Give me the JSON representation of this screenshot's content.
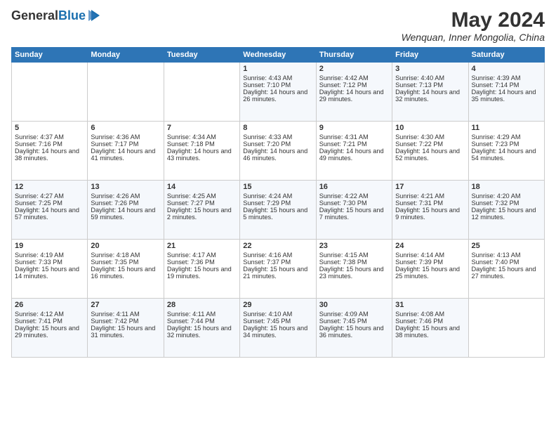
{
  "header": {
    "logo_line1": "General",
    "logo_line2": "Blue",
    "month_year": "May 2024",
    "location": "Wenquan, Inner Mongolia, China"
  },
  "days_of_week": [
    "Sunday",
    "Monday",
    "Tuesday",
    "Wednesday",
    "Thursday",
    "Friday",
    "Saturday"
  ],
  "weeks": [
    [
      {
        "day": "",
        "info": ""
      },
      {
        "day": "",
        "info": ""
      },
      {
        "day": "",
        "info": ""
      },
      {
        "day": "1",
        "info": "Sunrise: 4:43 AM\nSunset: 7:10 PM\nDaylight: 14 hours and 26 minutes."
      },
      {
        "day": "2",
        "info": "Sunrise: 4:42 AM\nSunset: 7:12 PM\nDaylight: 14 hours and 29 minutes."
      },
      {
        "day": "3",
        "info": "Sunrise: 4:40 AM\nSunset: 7:13 PM\nDaylight: 14 hours and 32 minutes."
      },
      {
        "day": "4",
        "info": "Sunrise: 4:39 AM\nSunset: 7:14 PM\nDaylight: 14 hours and 35 minutes."
      }
    ],
    [
      {
        "day": "5",
        "info": "Sunrise: 4:37 AM\nSunset: 7:16 PM\nDaylight: 14 hours and 38 minutes."
      },
      {
        "day": "6",
        "info": "Sunrise: 4:36 AM\nSunset: 7:17 PM\nDaylight: 14 hours and 41 minutes."
      },
      {
        "day": "7",
        "info": "Sunrise: 4:34 AM\nSunset: 7:18 PM\nDaylight: 14 hours and 43 minutes."
      },
      {
        "day": "8",
        "info": "Sunrise: 4:33 AM\nSunset: 7:20 PM\nDaylight: 14 hours and 46 minutes."
      },
      {
        "day": "9",
        "info": "Sunrise: 4:31 AM\nSunset: 7:21 PM\nDaylight: 14 hours and 49 minutes."
      },
      {
        "day": "10",
        "info": "Sunrise: 4:30 AM\nSunset: 7:22 PM\nDaylight: 14 hours and 52 minutes."
      },
      {
        "day": "11",
        "info": "Sunrise: 4:29 AM\nSunset: 7:23 PM\nDaylight: 14 hours and 54 minutes."
      }
    ],
    [
      {
        "day": "12",
        "info": "Sunrise: 4:27 AM\nSunset: 7:25 PM\nDaylight: 14 hours and 57 minutes."
      },
      {
        "day": "13",
        "info": "Sunrise: 4:26 AM\nSunset: 7:26 PM\nDaylight: 14 hours and 59 minutes."
      },
      {
        "day": "14",
        "info": "Sunrise: 4:25 AM\nSunset: 7:27 PM\nDaylight: 15 hours and 2 minutes."
      },
      {
        "day": "15",
        "info": "Sunrise: 4:24 AM\nSunset: 7:29 PM\nDaylight: 15 hours and 5 minutes."
      },
      {
        "day": "16",
        "info": "Sunrise: 4:22 AM\nSunset: 7:30 PM\nDaylight: 15 hours and 7 minutes."
      },
      {
        "day": "17",
        "info": "Sunrise: 4:21 AM\nSunset: 7:31 PM\nDaylight: 15 hours and 9 minutes."
      },
      {
        "day": "18",
        "info": "Sunrise: 4:20 AM\nSunset: 7:32 PM\nDaylight: 15 hours and 12 minutes."
      }
    ],
    [
      {
        "day": "19",
        "info": "Sunrise: 4:19 AM\nSunset: 7:33 PM\nDaylight: 15 hours and 14 minutes."
      },
      {
        "day": "20",
        "info": "Sunrise: 4:18 AM\nSunset: 7:35 PM\nDaylight: 15 hours and 16 minutes."
      },
      {
        "day": "21",
        "info": "Sunrise: 4:17 AM\nSunset: 7:36 PM\nDaylight: 15 hours and 19 minutes."
      },
      {
        "day": "22",
        "info": "Sunrise: 4:16 AM\nSunset: 7:37 PM\nDaylight: 15 hours and 21 minutes."
      },
      {
        "day": "23",
        "info": "Sunrise: 4:15 AM\nSunset: 7:38 PM\nDaylight: 15 hours and 23 minutes."
      },
      {
        "day": "24",
        "info": "Sunrise: 4:14 AM\nSunset: 7:39 PM\nDaylight: 15 hours and 25 minutes."
      },
      {
        "day": "25",
        "info": "Sunrise: 4:13 AM\nSunset: 7:40 PM\nDaylight: 15 hours and 27 minutes."
      }
    ],
    [
      {
        "day": "26",
        "info": "Sunrise: 4:12 AM\nSunset: 7:41 PM\nDaylight: 15 hours and 29 minutes."
      },
      {
        "day": "27",
        "info": "Sunrise: 4:11 AM\nSunset: 7:42 PM\nDaylight: 15 hours and 31 minutes."
      },
      {
        "day": "28",
        "info": "Sunrise: 4:11 AM\nSunset: 7:44 PM\nDaylight: 15 hours and 32 minutes."
      },
      {
        "day": "29",
        "info": "Sunrise: 4:10 AM\nSunset: 7:45 PM\nDaylight: 15 hours and 34 minutes."
      },
      {
        "day": "30",
        "info": "Sunrise: 4:09 AM\nSunset: 7:45 PM\nDaylight: 15 hours and 36 minutes."
      },
      {
        "day": "31",
        "info": "Sunrise: 4:08 AM\nSunset: 7:46 PM\nDaylight: 15 hours and 38 minutes."
      },
      {
        "day": "",
        "info": ""
      }
    ]
  ]
}
